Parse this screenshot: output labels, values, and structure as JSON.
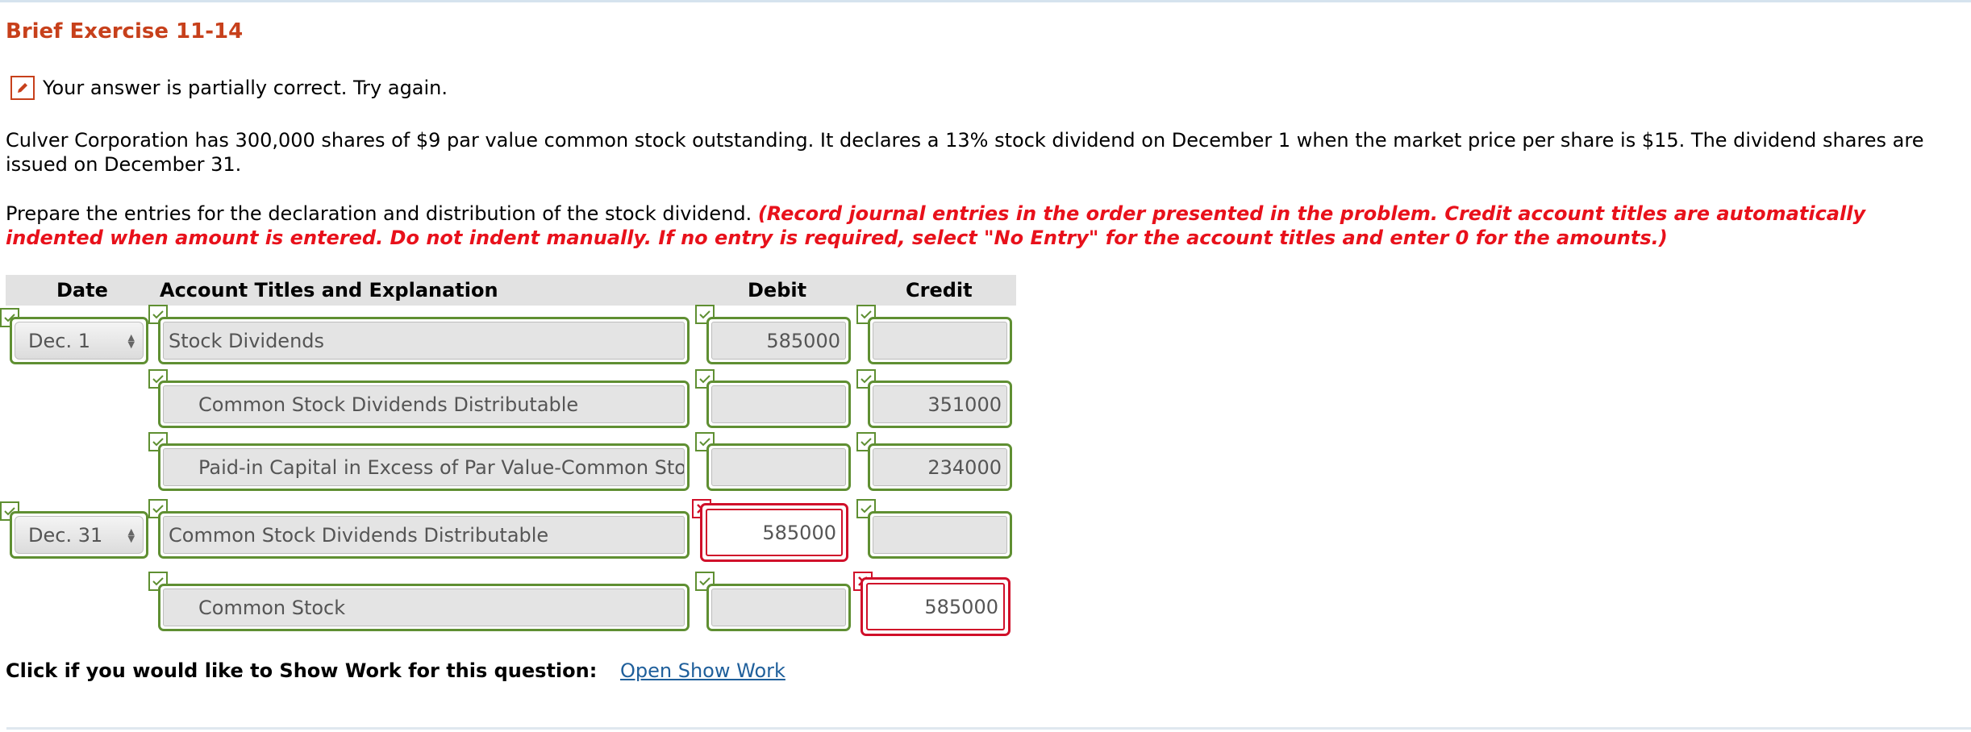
{
  "exercise_title": "Brief Exercise 11-14",
  "status": {
    "icon": "pencil-icon",
    "text": "Your answer is partially correct.  Try again."
  },
  "problem_text": "Culver Corporation has 300,000 shares of $9 par value common stock outstanding. It declares a 13% stock dividend on December 1 when the market price per share is $15. The dividend shares are issued on December 31.",
  "prepare_text": "Prepare the entries for the declaration and distribution of the stock dividend.",
  "instruction_text": "(Record journal entries in the order presented in the problem. Credit account titles are automatically indented when amount is entered. Do not indent manually. If no entry is required, select \"No Entry\" for the account titles and enter 0 for the amounts.)",
  "table": {
    "headers": {
      "date": "Date",
      "account": "Account Titles and Explanation",
      "debit": "Debit",
      "credit": "Credit"
    },
    "rows": [
      {
        "date": "Dec. 1",
        "account": "Stock Dividends",
        "debit": "585000",
        "credit": "",
        "date_status": "correct",
        "account_status": "correct",
        "debit_status": "correct",
        "credit_status": "correct"
      },
      {
        "date": "",
        "account": "Common Stock Dividends Distributable",
        "debit": "",
        "credit": "351000",
        "account_status": "correct",
        "debit_status": "correct",
        "credit_status": "correct"
      },
      {
        "date": "",
        "account": "Paid-in Capital in Excess of Par Value-Common Stock",
        "debit": "",
        "credit": "234000",
        "account_status": "correct",
        "debit_status": "correct",
        "credit_status": "correct"
      },
      {
        "date": "Dec. 31",
        "account": "Common Stock Dividends Distributable",
        "debit": "585000",
        "credit": "",
        "date_status": "correct",
        "account_status": "correct",
        "debit_status": "incorrect",
        "credit_status": "correct"
      },
      {
        "date": "",
        "account": "Common Stock",
        "debit": "",
        "credit": "585000",
        "account_status": "correct",
        "debit_status": "correct",
        "credit_status": "incorrect"
      }
    ]
  },
  "show_work": {
    "label": "Click if you would like to Show Work for this question:",
    "link": "Open Show Work"
  },
  "colors": {
    "title": "#c7401b",
    "instruction": "#e8111b",
    "correct": "#5f8f32",
    "incorrect": "#d0102a",
    "link": "#1f5f9b"
  }
}
